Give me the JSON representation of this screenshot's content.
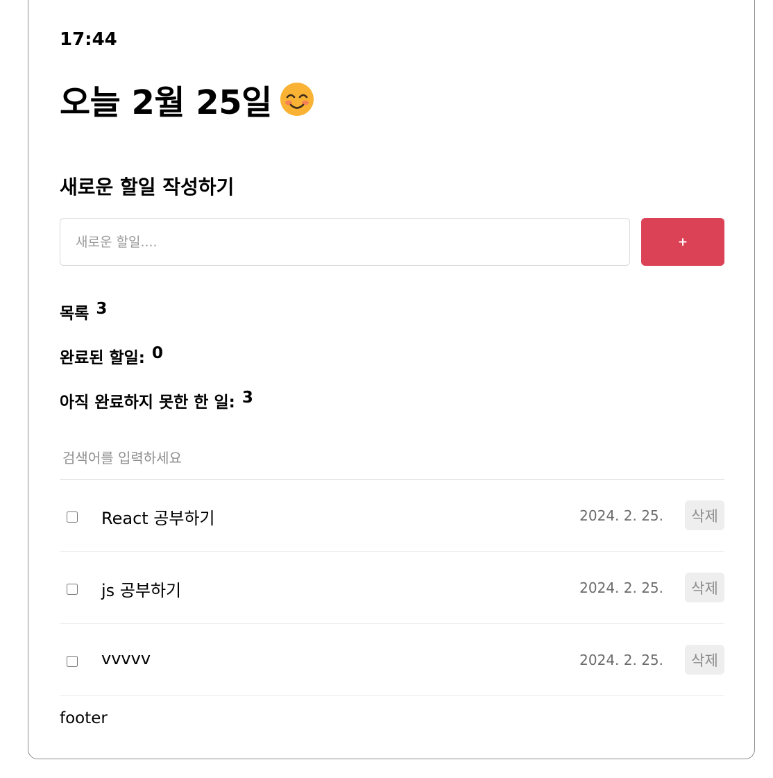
{
  "header": {
    "time": "17:44",
    "date_title": "오늘 2월 25일",
    "emoji": "smiling-face-icon"
  },
  "editor": {
    "title": "새로운 할일 작성하기",
    "input_placeholder": "새로운 할일....",
    "add_label": "+"
  },
  "stats": {
    "total_label": "목록",
    "total_count": "3",
    "done_label": "완료된 할일:",
    "done_count": "0",
    "todo_label": "아직 완료하지 못한 한 일:",
    "todo_count": "3"
  },
  "search": {
    "placeholder": "검색어를 입력하세요"
  },
  "todos": [
    {
      "text": "React 공부하기",
      "date": "2024. 2. 25.",
      "delete_label": "삭제",
      "checked": false
    },
    {
      "text": "js 공부하기",
      "date": "2024. 2. 25.",
      "delete_label": "삭제",
      "checked": false
    },
    {
      "text": "vvvvv",
      "date": "2024. 2. 25.",
      "delete_label": "삭제",
      "checked": false
    }
  ],
  "footer": {
    "text": "footer"
  },
  "colors": {
    "accent": "#dc4256",
    "emoji_yellow": "#f9b233"
  }
}
